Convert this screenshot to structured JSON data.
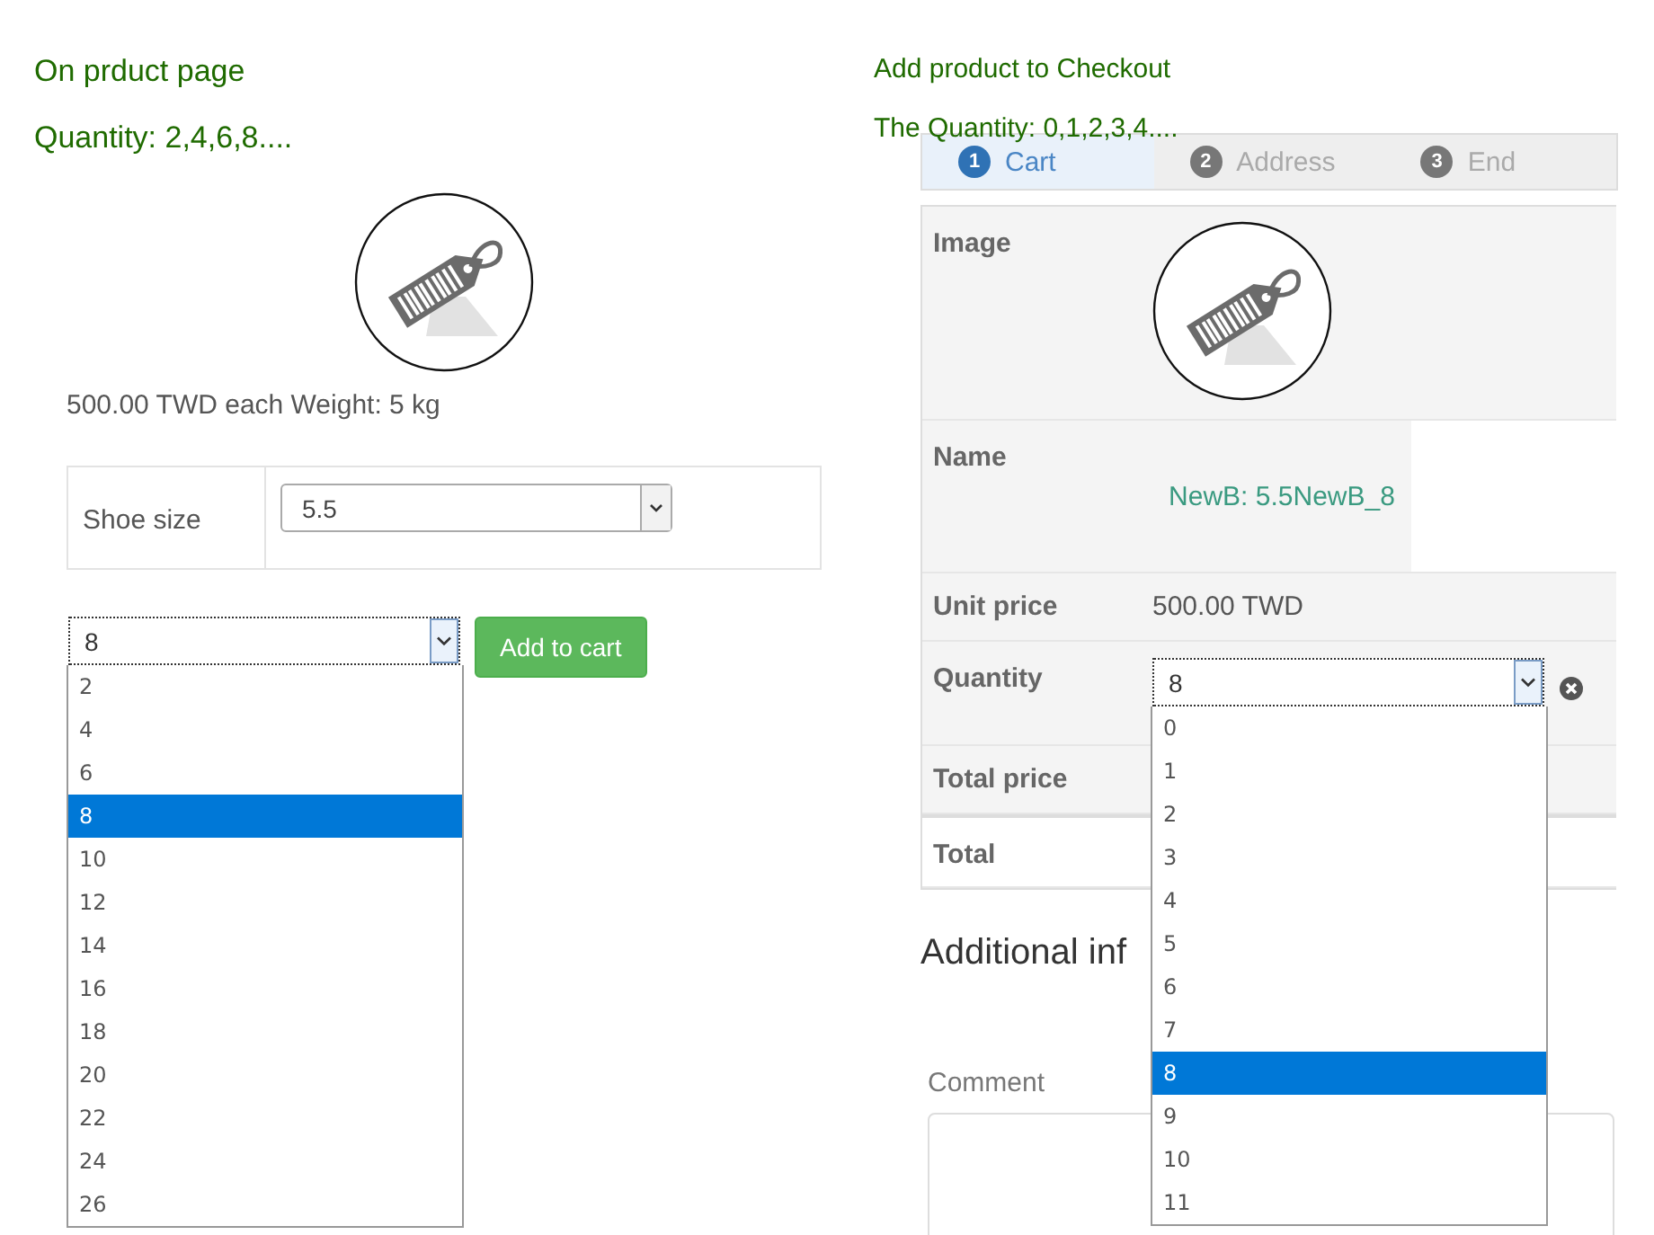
{
  "product_page": {
    "captions": [
      "On prduct page",
      "Quantity: 2,4,6,8...."
    ],
    "price_text": "500.00 TWD each Weight: 5 kg",
    "option": {
      "label": "Shoe size",
      "value": "5.5"
    },
    "quantity_select": {
      "value": "8",
      "open": true,
      "options": [
        {
          "label": "2",
          "selected": false
        },
        {
          "label": "4",
          "selected": false
        },
        {
          "label": "6",
          "selected": false
        },
        {
          "label": "8",
          "selected": true
        },
        {
          "label": "10",
          "selected": false
        },
        {
          "label": "12",
          "selected": false
        },
        {
          "label": "14",
          "selected": false
        },
        {
          "label": "16",
          "selected": false
        },
        {
          "label": "18",
          "selected": false
        },
        {
          "label": "20",
          "selected": false
        },
        {
          "label": "22",
          "selected": false
        },
        {
          "label": "24",
          "selected": false
        },
        {
          "label": "26",
          "selected": false
        }
      ]
    },
    "add_button": "Add to cart"
  },
  "checkout": {
    "captions": [
      "Add product to Checkout",
      "The Quantity: 0,1,2,3,4...."
    ],
    "steps": [
      {
        "number": "1",
        "label": "Cart",
        "selected": true
      },
      {
        "number": "2",
        "label": "Address",
        "selected": false
      },
      {
        "number": "3",
        "label": "End",
        "selected": false
      }
    ],
    "rows": [
      {
        "kind": "image",
        "label": "Image"
      },
      {
        "kind": "link",
        "label": "Name",
        "value": "NewB: 5.5NewB_8"
      },
      {
        "kind": "text",
        "label": "Unit price",
        "value": "500.00 TWD"
      },
      {
        "kind": "select",
        "label": "Quantity"
      },
      {
        "kind": "text",
        "label": "Total price"
      },
      {
        "kind": "total",
        "label": "Total"
      }
    ],
    "quantity_select": {
      "value": "8",
      "open": true,
      "options": [
        {
          "label": "0",
          "selected": false
        },
        {
          "label": "1",
          "selected": false
        },
        {
          "label": "2",
          "selected": false
        },
        {
          "label": "3",
          "selected": false
        },
        {
          "label": "4",
          "selected": false
        },
        {
          "label": "5",
          "selected": false
        },
        {
          "label": "6",
          "selected": false
        },
        {
          "label": "7",
          "selected": false
        },
        {
          "label": "8",
          "selected": true
        },
        {
          "label": "9",
          "selected": false
        },
        {
          "label": "10",
          "selected": false
        },
        {
          "label": "11",
          "selected": false
        }
      ]
    },
    "section_heading": "Additional inf",
    "comment_label": "Comment"
  }
}
